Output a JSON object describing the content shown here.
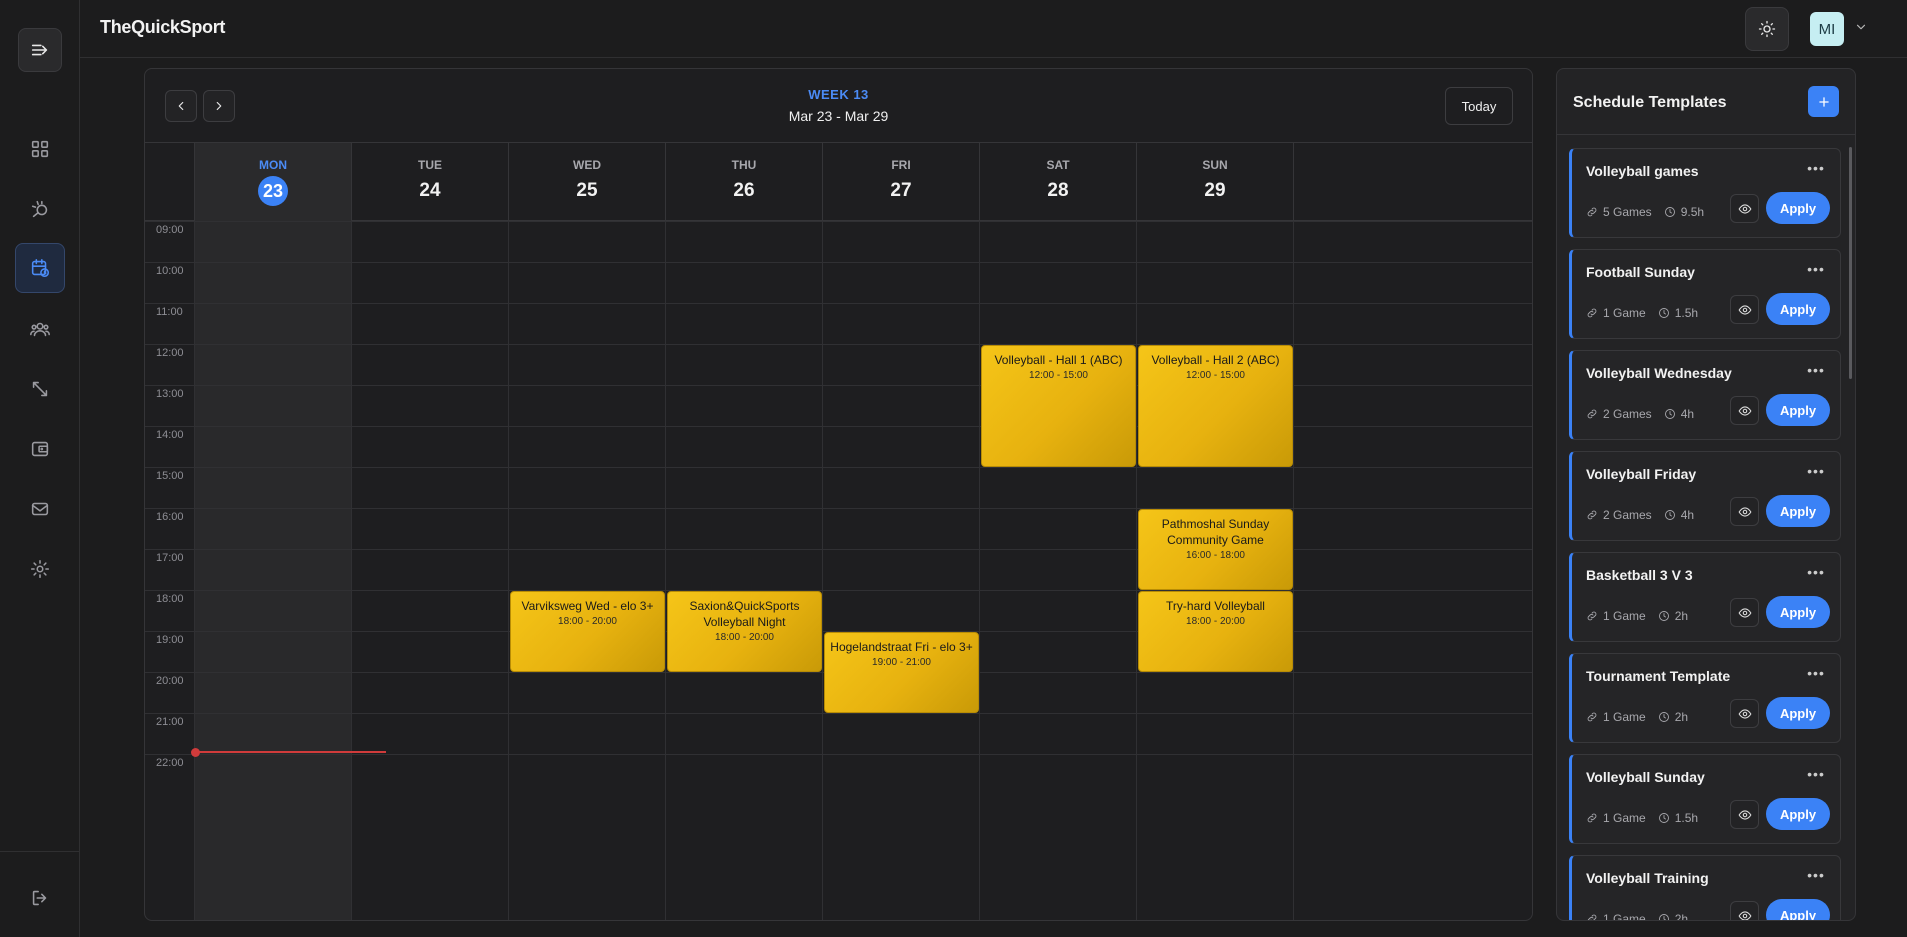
{
  "app": {
    "logo": "TheQuickSport"
  },
  "header": {
    "avatar_initials": "MI"
  },
  "sidebar": {
    "items": [
      {
        "name": "dashboard-icon"
      },
      {
        "name": "games-icon"
      },
      {
        "name": "schedule-icon",
        "active": true
      },
      {
        "name": "users-icon"
      },
      {
        "name": "expand-icon"
      },
      {
        "name": "wallet-icon"
      },
      {
        "name": "mail-icon"
      },
      {
        "name": "settings-icon"
      }
    ]
  },
  "calendar": {
    "week_label": "WEEK 13",
    "date_range": "Mar 23 - Mar 29",
    "today_label": "Today",
    "days": [
      {
        "name": "MON",
        "num": "23",
        "today": true
      },
      {
        "name": "TUE",
        "num": "24"
      },
      {
        "name": "WED",
        "num": "25"
      },
      {
        "name": "THU",
        "num": "26"
      },
      {
        "name": "FRI",
        "num": "27"
      },
      {
        "name": "SAT",
        "num": "28"
      },
      {
        "name": "SUN",
        "num": "29"
      }
    ],
    "hours": [
      "09:00",
      "10:00",
      "11:00",
      "12:00",
      "13:00",
      "14:00",
      "15:00",
      "16:00",
      "17:00",
      "18:00",
      "19:00",
      "20:00",
      "21:00",
      "22:00"
    ],
    "events": [
      {
        "day": 5,
        "title": "Volleyball - Hall 1 (ABC)",
        "time": "12:00 - 15:00",
        "start": 12,
        "end": 15
      },
      {
        "day": 6,
        "title": "Volleyball - Hall 2 (ABC)",
        "time": "12:00 - 15:00",
        "start": 12,
        "end": 15
      },
      {
        "day": 6,
        "title": "Pathmoshal Sunday Community Game",
        "time": "16:00 - 18:00",
        "start": 16,
        "end": 18
      },
      {
        "day": 2,
        "title": "Varviksweg Wed - elo 3+",
        "time": "18:00 - 20:00",
        "start": 18,
        "end": 20
      },
      {
        "day": 3,
        "title": "Saxion&QuickSports Volleyball Night",
        "time": "18:00 - 20:00",
        "start": 18,
        "end": 20
      },
      {
        "day": 6,
        "title": "Try-hard Volleyball",
        "time": "18:00 - 20:00",
        "start": 18,
        "end": 20
      },
      {
        "day": 4,
        "title": "Hogelandstraat Fri - elo 3+",
        "time": "19:00 - 21:00",
        "start": 19,
        "end": 21
      }
    ]
  },
  "templates": {
    "title": "Schedule Templates",
    "apply_label": "Apply",
    "items": [
      {
        "name": "Volleyball games",
        "games": "5 Games",
        "duration": "9.5h"
      },
      {
        "name": "Football Sunday",
        "games": "1 Game",
        "duration": "1.5h"
      },
      {
        "name": "Volleyball Wednesday",
        "games": "2 Games",
        "duration": "4h"
      },
      {
        "name": "Volleyball Friday",
        "games": "2 Games",
        "duration": "4h"
      },
      {
        "name": "Basketball 3 V 3",
        "games": "1 Game",
        "duration": "2h"
      },
      {
        "name": "Tournament Template",
        "games": "1 Game",
        "duration": "2h"
      },
      {
        "name": "Volleyball Sunday",
        "games": "1 Game",
        "duration": "1.5h"
      },
      {
        "name": "Volleyball Training",
        "games": "1 Game",
        "duration": "2h"
      }
    ]
  },
  "colors": {
    "accent": "#3b82f6",
    "event": "#f5c518",
    "now_line": "#d03b3b"
  }
}
